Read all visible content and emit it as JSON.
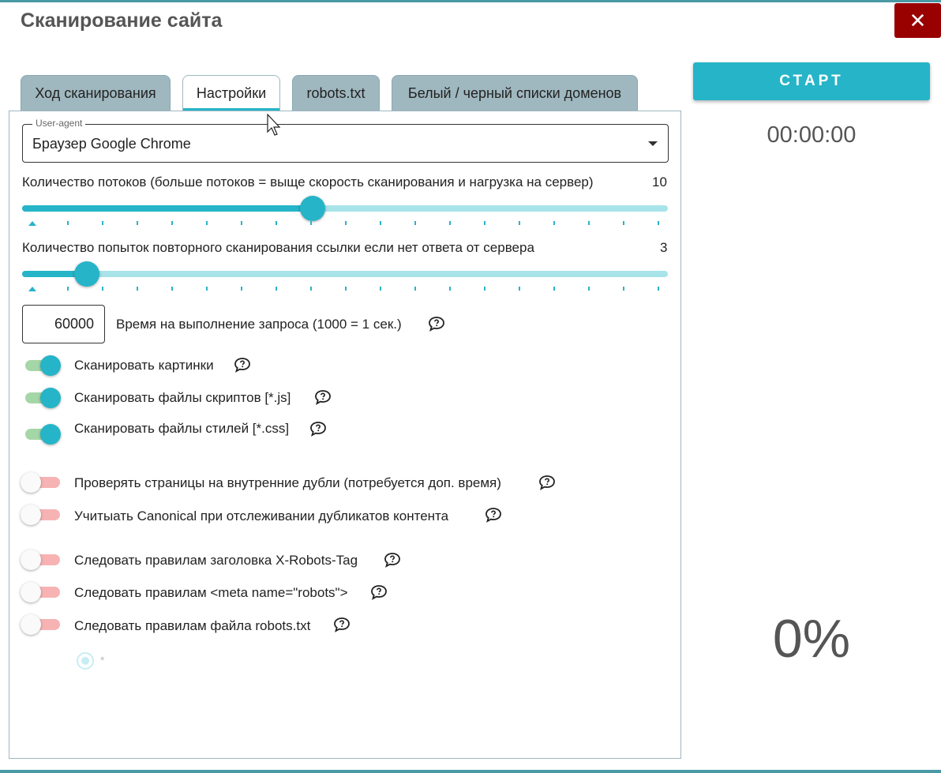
{
  "dialog": {
    "title": "Сканирование сайта",
    "close_icon": "close-icon",
    "close_glyph": "✕"
  },
  "tabs": [
    {
      "label": "Ход сканирования",
      "active": false
    },
    {
      "label": "Настройки",
      "active": true
    },
    {
      "label": "robots.txt",
      "active": false
    },
    {
      "label": "Белый / черный списки доменов",
      "active": false
    }
  ],
  "user_agent": {
    "legend": "User-agent",
    "value": "Браузер Google Chrome"
  },
  "threads": {
    "label": "Количество потоков (больше потоков = выще скорость сканирования и нагрузка на сервер)",
    "value": "10",
    "min": 1,
    "max": 20,
    "current": 10
  },
  "retries": {
    "label": "Количество попыток повторного сканирования ссылки если нет ответа от сервера",
    "value": "3",
    "min": 1,
    "max": 20,
    "current": 3
  },
  "timeout": {
    "value": "60000",
    "label": "Время на выполнение запроса (1000 = 1 сек.)"
  },
  "toggles": [
    {
      "label": "Сканировать картинки",
      "on": true
    },
    {
      "label": "Сканировать файлы скриптов [*.js]",
      "on": true
    },
    {
      "label": "Сканировать файлы стилей [*.css]",
      "on": true
    },
    {
      "label": "Проверять страницы на внутренние дубли (потребуется доп. время)",
      "on": false
    },
    {
      "label": "Учитыать Canonical при отслеживании дубликатов контента",
      "on": false
    },
    {
      "label": "Следовать правилам заголовка X-Robots-Tag",
      "on": false
    },
    {
      "label": "Следовать правилам <meta name=\"robots\">",
      "on": false
    },
    {
      "label": "Следовать правилам файла robots.txt",
      "on": false
    }
  ],
  "robots_user_agent_option": {
    "label": "*",
    "selected": true
  },
  "start_button": {
    "label": "СТАРТ"
  },
  "timer": {
    "value": "00:00:00"
  },
  "progress": {
    "percent_text": "0%",
    "percent": 0
  },
  "colors": {
    "accent": "#26b4c8",
    "close": "#990000",
    "tab_inactive": "#9fb7bf"
  }
}
